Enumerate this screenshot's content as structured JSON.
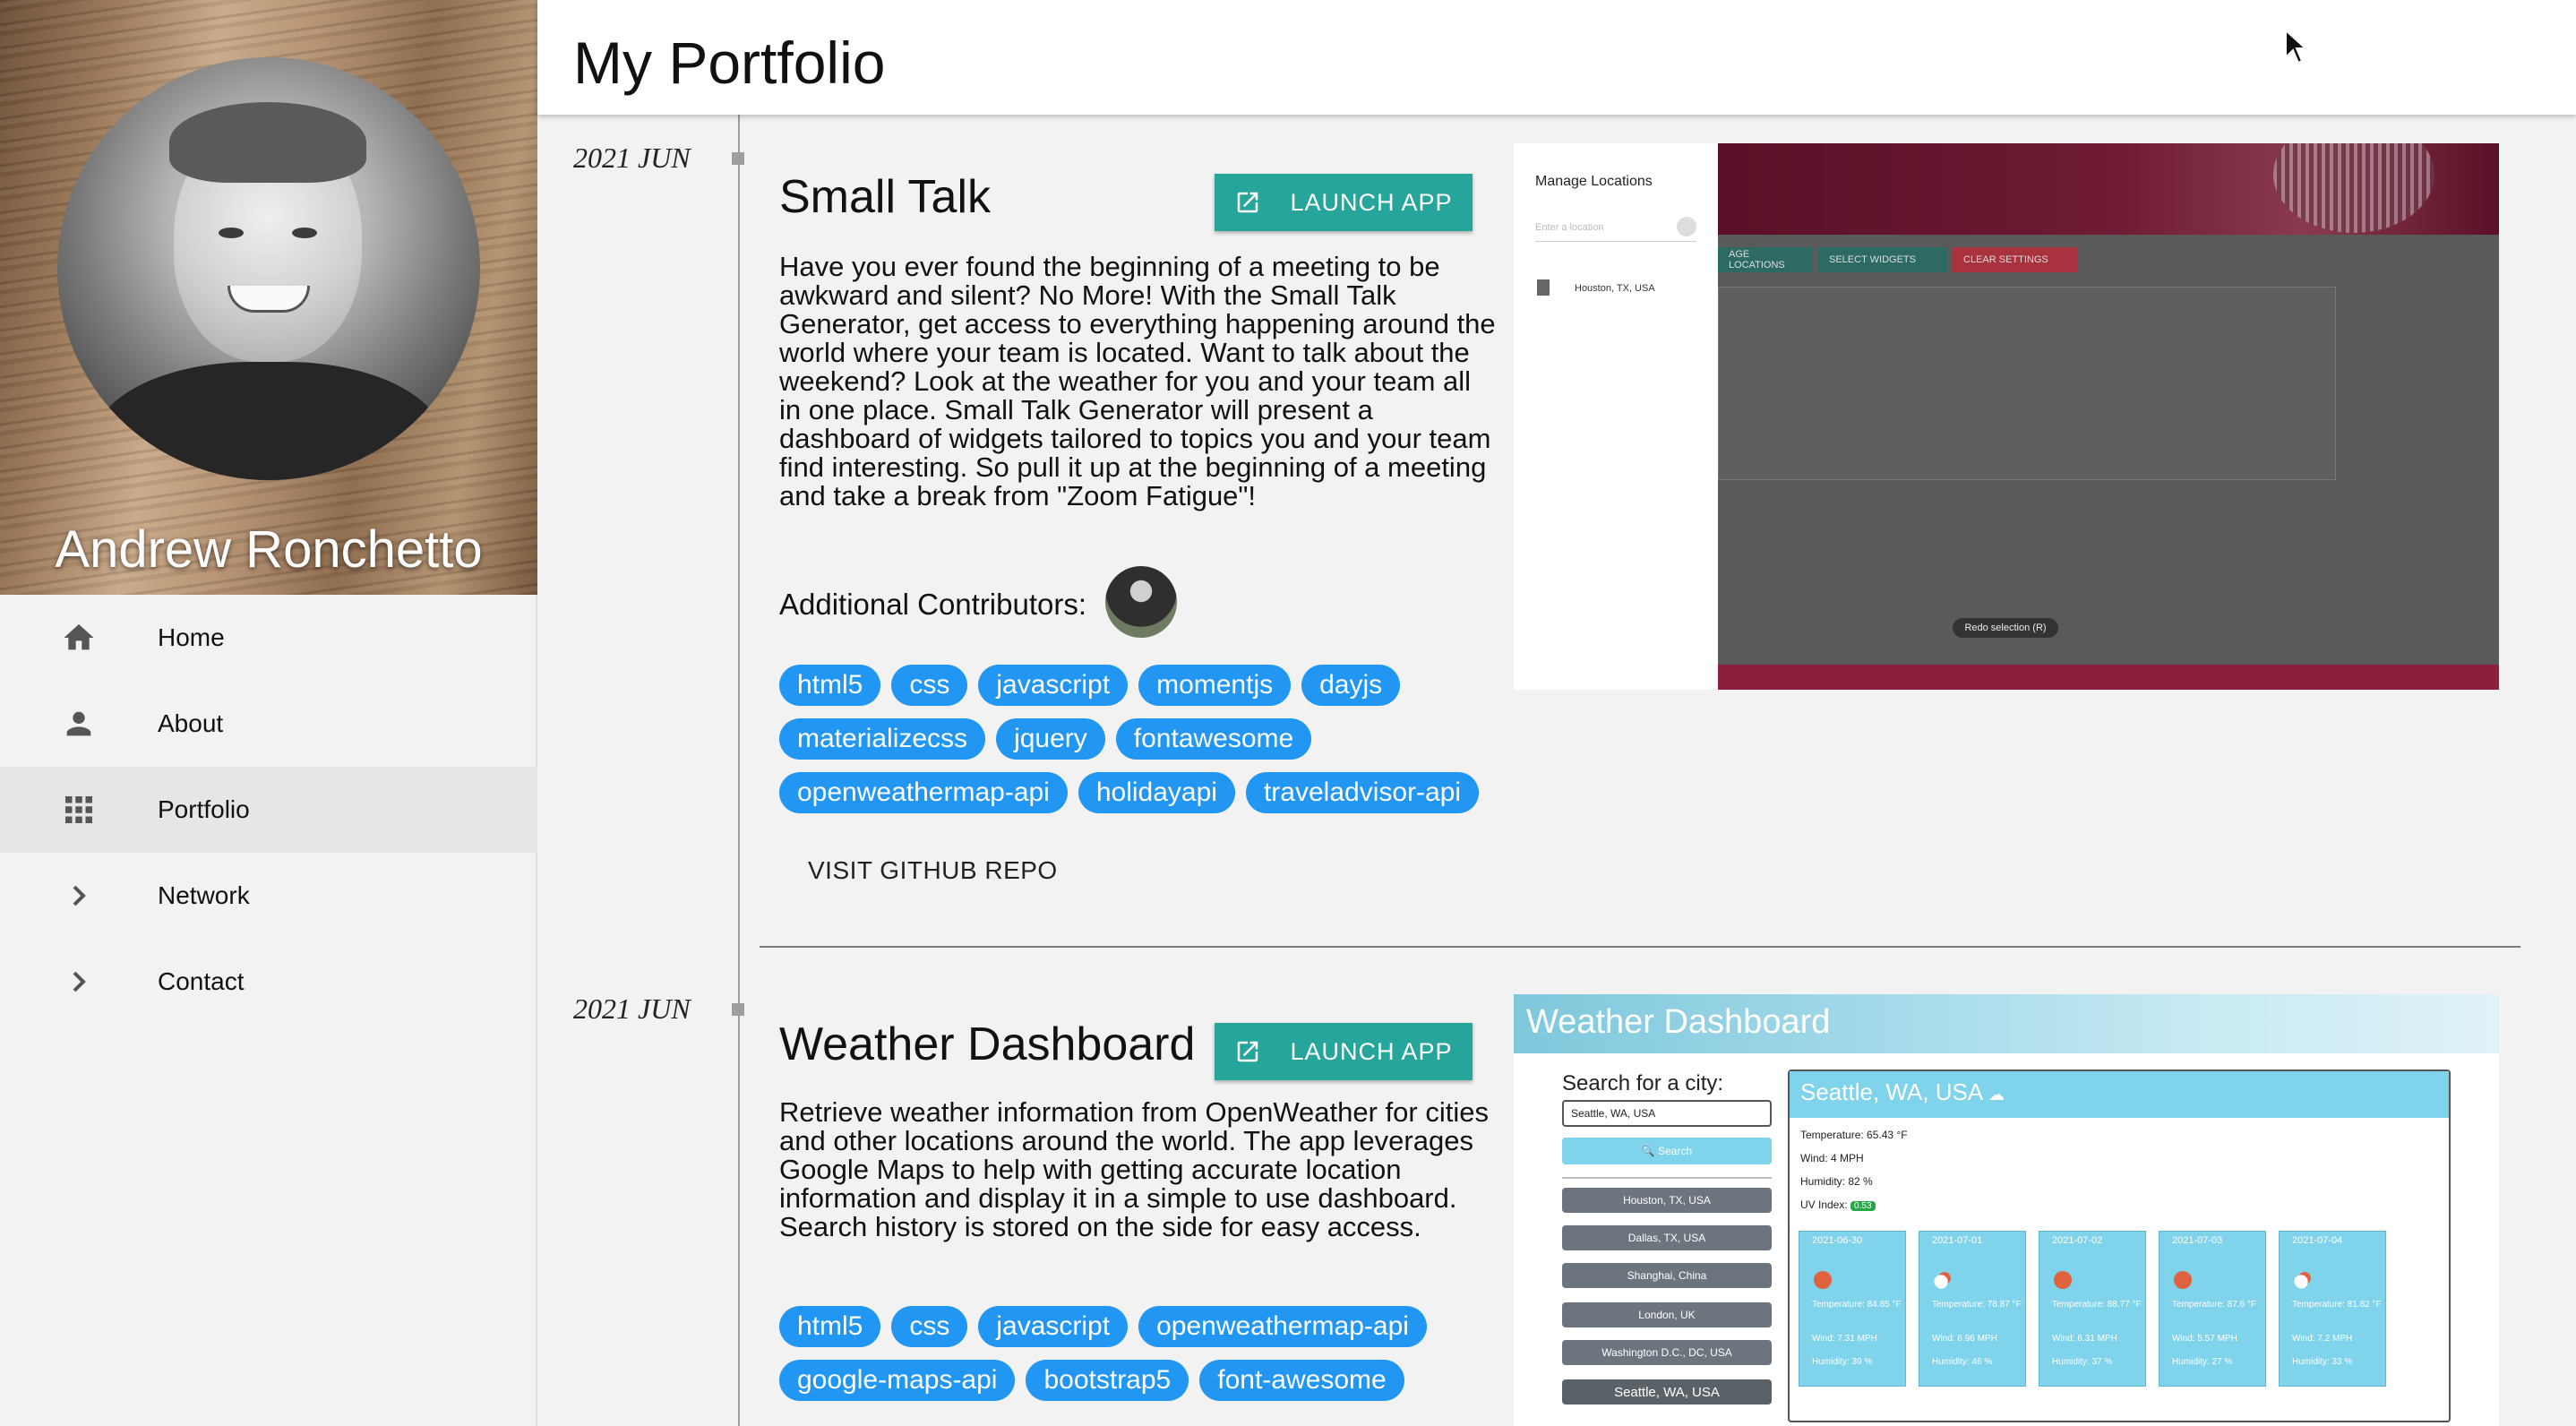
{
  "profile": {
    "name": "Andrew Ronchetto"
  },
  "nav": [
    {
      "label": "Home",
      "icon": "home-icon"
    },
    {
      "label": "About",
      "icon": "person-icon"
    },
    {
      "label": "Portfolio",
      "icon": "grid-icon",
      "active": true
    },
    {
      "label": "Network",
      "icon": "chevron-right-icon"
    },
    {
      "label": "Contact",
      "icon": "chevron-right-icon"
    }
  ],
  "header": {
    "title": "My Portfolio"
  },
  "colors": {
    "accent": "#26a69a",
    "tag": "#2196f3"
  },
  "projects": [
    {
      "date": "2021 JUN",
      "title": "Small Talk",
      "launch_label": "LAUNCH APP",
      "description": "Have you ever found the beginning of a meeting to be awkward and silent? No More! With the Small Talk Generator, get access to everything happening around the world where your team is located. Want to talk about the weekend? Look at the weather for you and your team all in one place. Small Talk Generator will present a dashboard of widgets tailored to topics you and your team find interesting. So pull it up at the beginning of a meeting and take a break from \"Zoom Fatigue\"!",
      "contributors_label": "Additional Contributors:",
      "tags": [
        "html5",
        "css",
        "javascript",
        "momentjs",
        "dayjs",
        "materializecss",
        "jquery",
        "fontawesome",
        "openweathermap-api",
        "holidayapi",
        "traveladvisor-api"
      ],
      "repo_label": "VISIT GITHUB REPO",
      "screenshot": {
        "panel_title": "Manage Locations",
        "input_placeholder": "Enter a location",
        "location": "Houston, TX, USA",
        "btn_manage": "AGE LOCATIONS",
        "btn_select": "SELECT WIDGETS",
        "btn_clear": "CLEAR SETTINGS",
        "redo": "Redo selection (R)"
      }
    },
    {
      "date": "2021 JUN",
      "title": "Weather Dashboard",
      "launch_label": "LAUNCH APP",
      "description": "Retrieve weather information from OpenWeather for cities and other locations around the world. The app leverages Google Maps to help with getting accurate location information and display it in a simple to use dashboard. Search history is stored on the side for easy access.",
      "tags": [
        "html5",
        "css",
        "javascript",
        "openweathermap-api",
        "google-maps-api",
        "bootstrap5",
        "font-awesome"
      ],
      "screenshot": {
        "app_title": "Weather Dashboard",
        "search_label": "Search for a city:",
        "search_value": "Seattle, WA, USA",
        "search_button": "Search",
        "history": [
          "Houston, TX, USA",
          "Dallas, TX, USA",
          "Shanghai, China",
          "London, UK",
          "Washington D.C., DC, USA",
          "Seattle, WA, USA"
        ],
        "city": "Seattle, WA, USA",
        "temperature": "Temperature: 65.43 °F",
        "wind": "Wind: 4 MPH",
        "humidity": "Humidity: 82 %",
        "uv_label": "UV Index:",
        "uv_value": "0.53",
        "forecast": [
          {
            "date": "2021-06-30",
            "temp": "Temperature: 84.85 °F",
            "wind": "Wind: 7.31 MPH",
            "humidity": "Humidity: 39 %",
            "icon": "sun-icon"
          },
          {
            "date": "2021-07-01",
            "temp": "Temperature: 78.87 °F",
            "wind": "Wind: 6.96 MPH",
            "humidity": "Humidity: 46 %",
            "icon": "partly-cloudy-icon"
          },
          {
            "date": "2021-07-02",
            "temp": "Temperature: 88.77 °F",
            "wind": "Wind: 6.31 MPH",
            "humidity": "Humidity: 37 %",
            "icon": "sun-icon"
          },
          {
            "date": "2021-07-03",
            "temp": "Temperature: 87.6 °F",
            "wind": "Wind: 5.57 MPH",
            "humidity": "Humidity: 27 %",
            "icon": "sun-icon"
          },
          {
            "date": "2021-07-04",
            "temp": "Temperature: 81.82 °F",
            "wind": "Wind: 7.2 MPH",
            "humidity": "Humidity: 33 %",
            "icon": "partly-cloudy-icon"
          }
        ]
      }
    }
  ]
}
